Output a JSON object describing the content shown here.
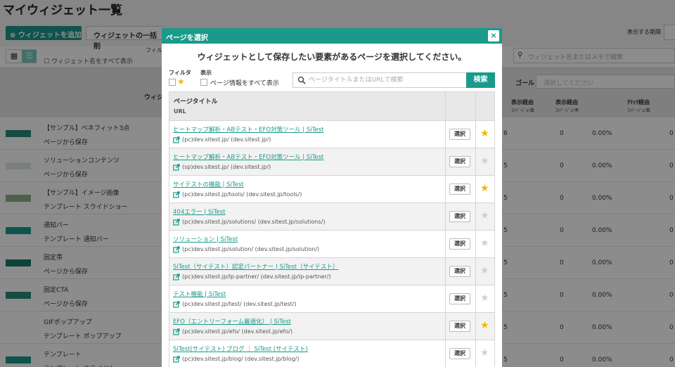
{
  "background": {
    "page_title": "マイウィジェット一覧",
    "add_button": "ウィジェットを追加",
    "bulk_button": "ウィジェットの一括削",
    "period_label": "表示する期間",
    "filter_label": "フィル",
    "show_all_label": "ウィジェット名をすべて表示",
    "search_placeholder": "ウィジェット名またはメモで検索",
    "widget_col": "ウィジェ",
    "goal_label": "ゴール",
    "goal_placeholder": "選択してください",
    "columns": [
      {
        "label": "表示経由",
        "sub": "ｺﾝﾊﾞｰｼﾞｮﾝ数"
      },
      {
        "label": "表示経由",
        "sub": "ｺﾝﾊﾞｰｼﾞｮﾝ率"
      },
      {
        "label": "ｸﾘｯｸ経由",
        "sub": "ｺﾝﾊﾞｰｼﾞｮﾝ数"
      }
    ],
    "rows": [
      {
        "name": "【サンプル】ベネフィット3点",
        "sub": "ページから保存",
        "cut": "6",
        "a": "0",
        "b": "0.00%",
        "c": "0"
      },
      {
        "name": "ソリューションコンテンツ",
        "sub": "ページから保存",
        "cut": "5",
        "a": "0",
        "b": "0.00%",
        "c": "0"
      },
      {
        "name": "【サンプル】イメージ画像",
        "sub": "テンプレート スライドショー",
        "cut": "5",
        "a": "0",
        "b": "0.00%",
        "c": "0"
      },
      {
        "name": "通知バー",
        "sub": "テンプレート 通知バー",
        "cut": "5",
        "a": "0",
        "b": "0.00%",
        "c": "0"
      },
      {
        "name": "固定帯",
        "sub": "ページから保存",
        "cut": "5",
        "a": "0",
        "b": "0.00%",
        "c": "0"
      },
      {
        "name": "固定CTA",
        "sub": "ページから保存",
        "cut": "5",
        "a": "0",
        "b": "0.00%",
        "c": "0"
      },
      {
        "name": "GIFポップアップ",
        "sub": "テンプレート ポップアップ",
        "cut": "5",
        "a": "0",
        "b": "0.00%",
        "c": "0"
      },
      {
        "name": "テンプレート",
        "sub": "テンプレート スライドショー",
        "cut": "5",
        "a": "0",
        "b": "0.00%",
        "c": "0"
      }
    ]
  },
  "modal": {
    "title": "ページを選択",
    "close": "×",
    "heading": "ウィジェットとして保存したい要素があるページを選択してください。",
    "filter_label": "フィルタ",
    "show_label": "表示",
    "show_all_label": "ページ情報をすべて表示",
    "search_placeholder": "ページタイトルまたはURLで検索",
    "search_button": "検索",
    "col_title": "ページタイトル",
    "col_url": "URL",
    "select_label": "選択",
    "accent_color": "#1a9a8a",
    "star_color": "#f2b800",
    "pages": [
      {
        "title": "ヒートマップ解析・ABテスト・EFO対策ツール | SiTest",
        "url": "(pc)dev.sitest.jp/ (dev.sitest.jp/)",
        "starred": true
      },
      {
        "title": "ヒートマップ解析・ABテスト・EFO対策ツール | SiTest",
        "url": "(sp)dev.sitest.jp/ (dev.sitest.jp/)",
        "starred": false
      },
      {
        "title": "サイテストの機能 | SiTest",
        "url": "(pc)dev.sitest.jp/tools/ (dev.sitest.jp/tools/)",
        "starred": true
      },
      {
        "title": "404エラー | SiTest",
        "url": "(pc)dev.sitest.jp/solutions/ (dev.sitest.jp/solutions/)",
        "starred": false
      },
      {
        "title": "ソリューション | SiTest",
        "url": "(pc)dev.sitest.jp/solution/ (dev.sitest.jp/solution/)",
        "starred": false
      },
      {
        "title": "SiTest（サイテスト）認定パートナー | SiTest（サイテスト）",
        "url": "(pc)dev.sitest.jp/lp-partner/ (dev.sitest.jp/lp-partner/)",
        "starred": false
      },
      {
        "title": "テスト機能 | SiTest",
        "url": "(pc)dev.sitest.jp/test/ (dev.sitest.jp/test/)",
        "starred": false
      },
      {
        "title": "EFO（エントリーフォーム最適化） | SiTest",
        "url": "(pc)dev.sitest.jp/efo/ (dev.sitest.jp/efo/)",
        "starred": true
      },
      {
        "title": "SiTest(サイテスト) ブログ ｜ SiTest (サイテスト)",
        "url": "(pc)dev.sitest.jp/blog/ (dev.sitest.jp/blog/)",
        "starred": false
      }
    ]
  }
}
